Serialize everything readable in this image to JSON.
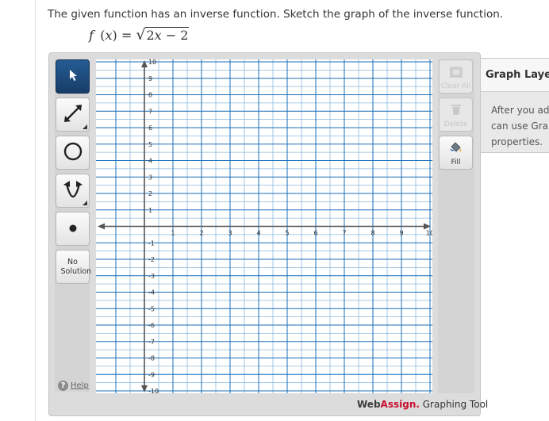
{
  "question": {
    "prompt": "The given function has an inverse function. Sketch the graph of the inverse function.",
    "formula": {
      "func": "f",
      "var": "x",
      "equals": "=",
      "radicand_coef": "2",
      "radicand_rest": " − 2"
    }
  },
  "tools": {
    "pointer": "pointer-arrow-icon",
    "line": "line-segment-icon",
    "circle": "circle-icon",
    "parabola": "parabola-icon",
    "point": "point-icon",
    "no_solution": "No Solution",
    "help_symbol": "?",
    "help": "Help"
  },
  "graph": {
    "x_min": -1,
    "x_max": 10,
    "y_min": -10,
    "y_max": 10,
    "grid_step": 0.5,
    "x_tick_labels": [
      "1",
      "2",
      "3",
      "4",
      "5",
      "6",
      "7",
      "8",
      "9",
      "10"
    ],
    "y_tick_labels": [
      "10",
      "9",
      "8",
      "7",
      "6",
      "5",
      "4",
      "3",
      "2",
      "1",
      "-1",
      "-2",
      "-3",
      "-4",
      "-5",
      "-6",
      "-7",
      "-8",
      "-9",
      "-10"
    ],
    "colors": {
      "major_grid": "#1a6fb8",
      "minor_grid": "#8cb9dd",
      "axis": "#555555"
    }
  },
  "right_tools": {
    "clear_all": "Clear All",
    "delete": "Delete",
    "fill": "Fill"
  },
  "brand": {
    "web": "Web",
    "assign": "Assign.",
    "tail": " Graphing Tool"
  },
  "layers": {
    "title": "Graph Layers",
    "body_line1": "After you add",
    "body_line2": "can use Graph",
    "body_line3": "properties."
  }
}
